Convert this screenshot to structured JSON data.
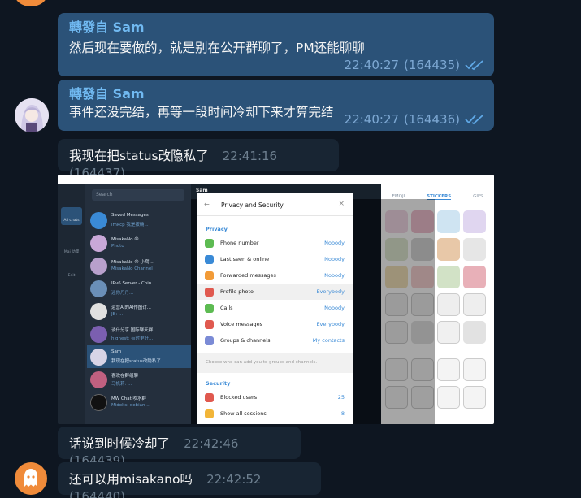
{
  "messages": [
    {
      "forwarded_label": "轉發自",
      "forwarded_from": "Sam",
      "text": "然后现在要做的，就是别在公开群聊了，PM还能聊聊",
      "time": "22:40:27",
      "id": "(164435)"
    },
    {
      "forwarded_label": "轉發自",
      "forwarded_from": "Sam",
      "text": "事件还没完结，再等一段时间冷却下来才算完结",
      "time": "22:40:27",
      "id": "(164436)"
    },
    {
      "text": "我现在把status改隐私了",
      "time": "22:41:16",
      "id": "(164437)"
    },
    {
      "text": "话说到时候冷却了",
      "time": "22:42:46",
      "id": "(164439)"
    },
    {
      "text": "还可以用misakano吗",
      "time": "22:42:52",
      "id": "(164440)"
    }
  ],
  "screenshot": {
    "title": "Sam",
    "search_placeholder": "Search",
    "rail": [
      "All chats",
      "Mai 动漫",
      "Edit"
    ],
    "chats": [
      {
        "name": "Saved Messages",
        "snippet": "imkcp 我是按确..."
      },
      {
        "name": "MisakaNo の ...",
        "snippet": "Photo"
      },
      {
        "name": "MisakaNo の 小窝...",
        "snippet": "MisakaNo Channel"
      },
      {
        "name": "IPv6 Server - Chin...",
        "snippet": "迷你丹丹..."
      },
      {
        "name": "运营AI的AI作图讨...",
        "snippet": "JB: ..."
      },
      {
        "name": "谈什分享 国际聊天群",
        "snippet": "highest: 有时更好..."
      },
      {
        "name": "Sam",
        "snippet": "我现在把status改隐私了"
      },
      {
        "name": "喜欢在群组聊",
        "snippet": "马帆莉: ..."
      },
      {
        "name": "MW Chat 吹水群",
        "snippet": "Midoks: debian ..."
      }
    ],
    "modal": {
      "title": "Privacy and Security",
      "section_privacy": "Privacy",
      "rows": [
        {
          "label": "Phone number",
          "value": "Nobody"
        },
        {
          "label": "Last seen & online",
          "value": "Nobody"
        },
        {
          "label": "Forwarded messages",
          "value": "Nobody"
        },
        {
          "label": "Profile photo",
          "value": "Everybody"
        },
        {
          "label": "Calls",
          "value": "Nobody"
        },
        {
          "label": "Voice messages",
          "value": "Everybody"
        },
        {
          "label": "Groups & channels",
          "value": "My contacts"
        }
      ],
      "note": "Choose who can add you to groups and channels.",
      "section_security": "Security",
      "security_rows": [
        {
          "label": "Blocked users",
          "value": "25"
        },
        {
          "label": "Show all sessions",
          "value": "8"
        }
      ]
    },
    "sticker_tabs": [
      "EMOJI",
      "STICKERS",
      "GIFS"
    ]
  },
  "colors": {
    "background": "#0e1621",
    "outgoing_bubble": "#2b5278",
    "incoming_bubble": "#182533",
    "accent": "#71baf2"
  },
  "icons": [
    "double-check-icon",
    "ghost-avatar-icon"
  ]
}
